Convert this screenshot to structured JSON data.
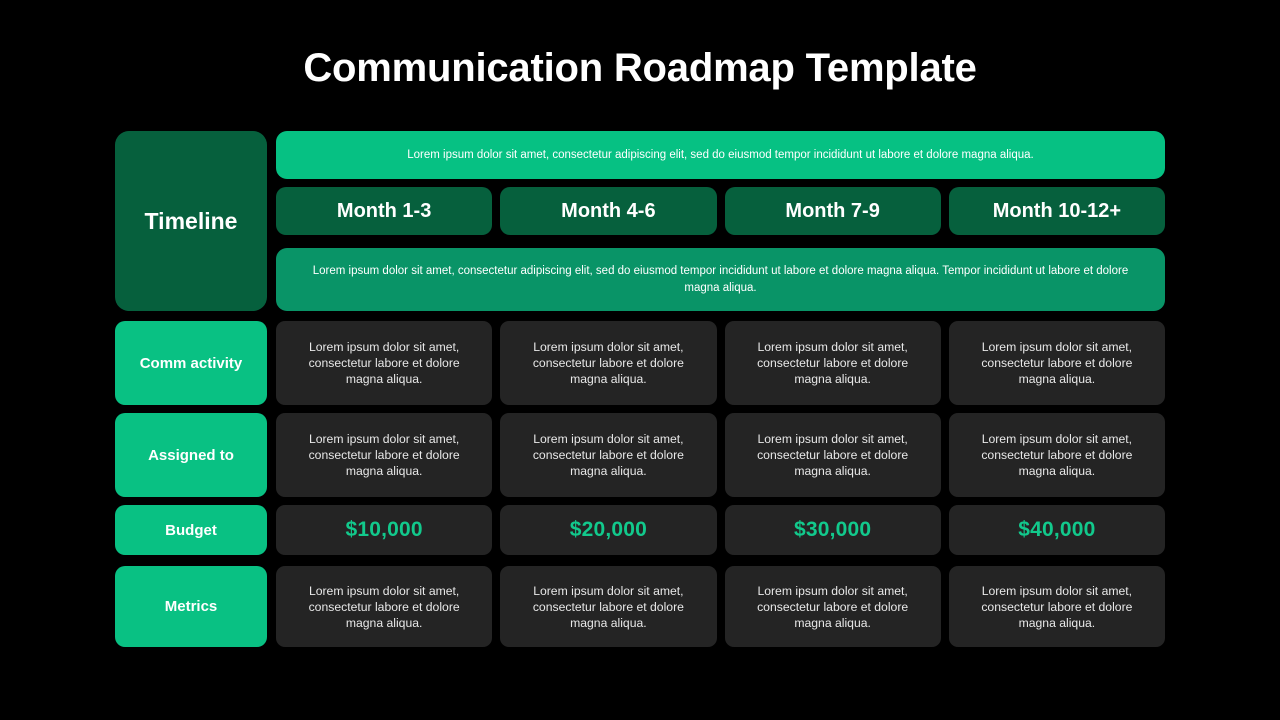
{
  "title": "Communication Roadmap Template",
  "colors": {
    "background": "#000000",
    "accent_bright": "#09c183",
    "accent_mid": "#099467",
    "accent_dark": "#06603d",
    "cell_bg": "#242424",
    "money_text": "#12c98c",
    "text": "#ffffff"
  },
  "row_labels": {
    "timeline": "Timeline",
    "comm_activity": "Comm activity",
    "assigned_to": "Assigned to",
    "budget": "Budget",
    "metrics": "Metrics"
  },
  "timeline": {
    "banner_top": "Lorem ipsum dolor sit amet, consectetur adipiscing elit, sed do eiusmod tempor incididunt ut labore et dolore magna aliqua.",
    "banner_bottom": "Lorem ipsum dolor sit amet, consectetur adipiscing elit, sed do eiusmod tempor incididunt ut labore et dolore magna aliqua. Tempor incididunt ut labore et dolore magna aliqua.",
    "months": [
      "Month 1-3",
      "Month 4-6",
      "Month 7-9",
      "Month 10-12+"
    ]
  },
  "rows": {
    "comm_activity": [
      "Lorem ipsum dolor sit amet, consectetur labore et dolore magna aliqua.",
      "Lorem ipsum dolor sit amet, consectetur labore et dolore magna aliqua.",
      "Lorem ipsum dolor sit amet, consectetur labore et dolore magna aliqua.",
      "Lorem ipsum dolor sit amet, consectetur labore et dolore magna aliqua."
    ],
    "assigned_to": [
      "Lorem ipsum dolor sit amet, consectetur labore et dolore magna aliqua.",
      "Lorem ipsum dolor sit amet, consectetur labore et dolore magna aliqua.",
      "Lorem ipsum dolor sit amet, consectetur labore et dolore magna aliqua.",
      "Lorem ipsum dolor sit amet, consectetur labore et dolore magna aliqua."
    ],
    "budget": [
      "$10,000",
      "$20,000",
      "$30,000",
      "$40,000"
    ],
    "metrics": [
      "Lorem ipsum dolor sit amet, consectetur labore et dolore magna aliqua.",
      "Lorem ipsum dolor sit amet, consectetur labore et dolore magna aliqua.",
      "Lorem ipsum dolor sit amet, consectetur labore et dolore magna aliqua.",
      "Lorem ipsum dolor sit amet, consectetur labore et dolore magna aliqua."
    ]
  }
}
